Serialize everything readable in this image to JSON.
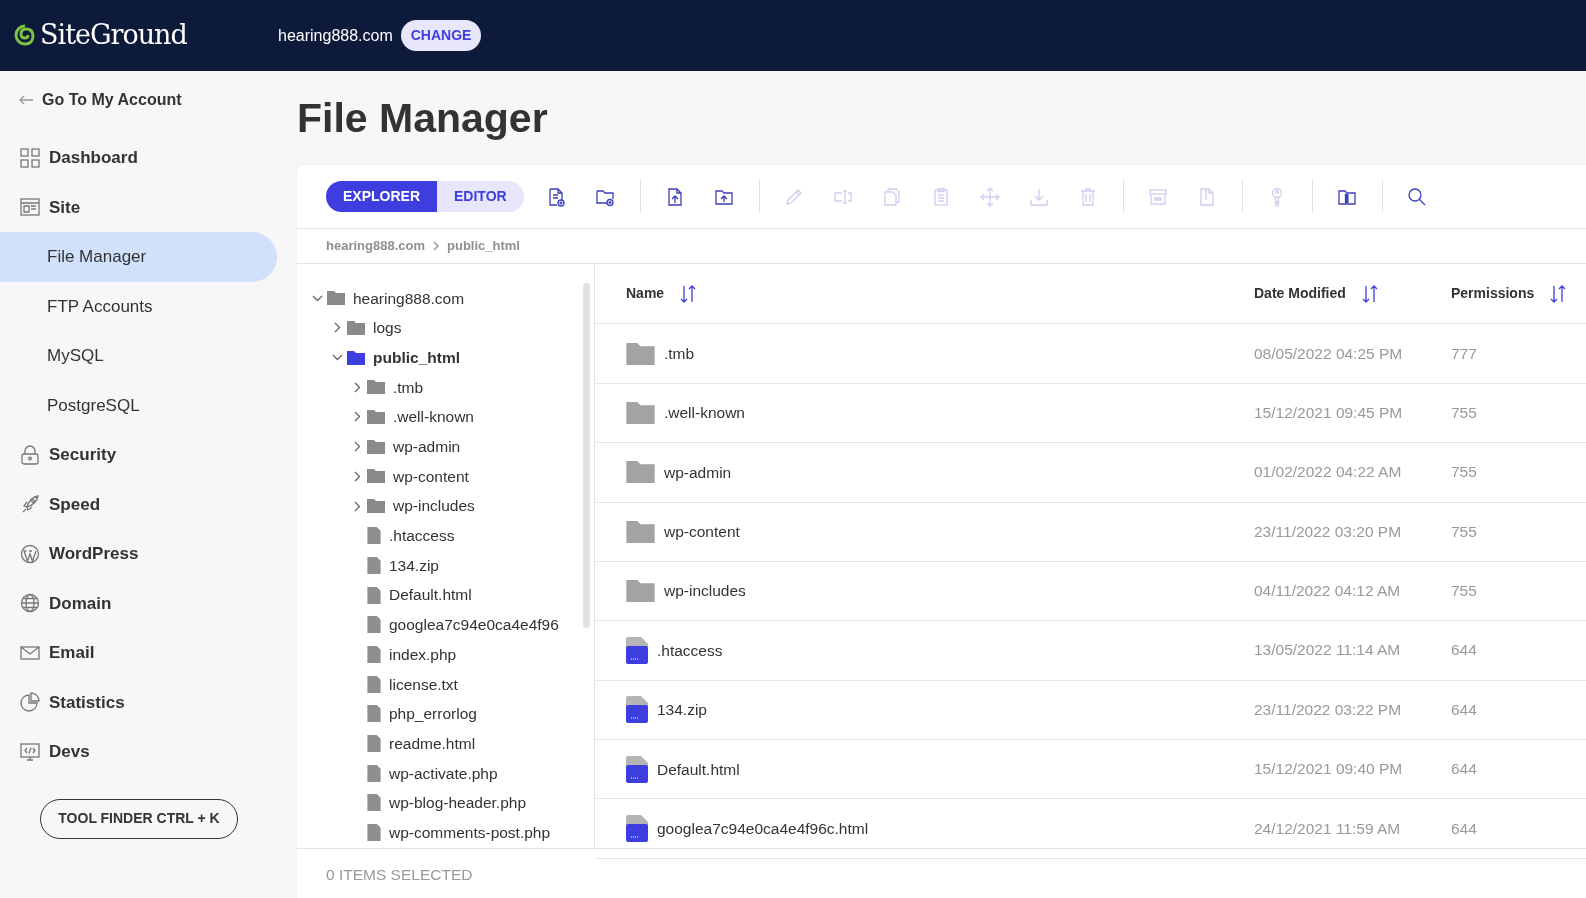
{
  "header": {
    "logo": "SiteGround",
    "site": "hearing888.com",
    "change_button": "CHANGE"
  },
  "sidebar": {
    "back_link": "Go To My Account",
    "items": [
      {
        "label": "Dashboard",
        "kind": "section",
        "selected": false
      },
      {
        "label": "Site",
        "kind": "section",
        "selected": false
      },
      {
        "label": "File Manager",
        "kind": "subitem",
        "selected": true
      },
      {
        "label": "FTP Accounts",
        "kind": "subitem",
        "selected": false
      },
      {
        "label": "MySQL",
        "kind": "subitem",
        "selected": false
      },
      {
        "label": "PostgreSQL",
        "kind": "subitem",
        "selected": false
      },
      {
        "label": "Security",
        "kind": "section",
        "selected": false
      },
      {
        "label": "Speed",
        "kind": "section",
        "selected": false
      },
      {
        "label": "WordPress",
        "kind": "section",
        "selected": false
      },
      {
        "label": "Domain",
        "kind": "section",
        "selected": false
      },
      {
        "label": "Email",
        "kind": "section",
        "selected": false
      },
      {
        "label": "Statistics",
        "kind": "section",
        "selected": false
      },
      {
        "label": "Devs",
        "kind": "section",
        "selected": false
      }
    ],
    "tool_finder": "TOOL FINDER CTRL + K"
  },
  "page_title": "File Manager",
  "toolbar": {
    "view_tabs": [
      {
        "label": "EXPLORER",
        "selected": true
      },
      {
        "label": "EDITOR",
        "selected": false
      }
    ],
    "tool_groups": [
      [
        {
          "kind": "new-file",
          "disabled": false
        },
        {
          "kind": "new-folder",
          "disabled": false
        }
      ],
      [
        {
          "kind": "upload-file",
          "disabled": false
        },
        {
          "kind": "upload-folder",
          "disabled": false
        }
      ],
      [
        {
          "kind": "edit",
          "disabled": true
        },
        {
          "kind": "rename",
          "disabled": true
        },
        {
          "kind": "copy",
          "disabled": true
        },
        {
          "kind": "paste",
          "disabled": true
        },
        {
          "kind": "move",
          "disabled": true
        },
        {
          "kind": "download",
          "disabled": true
        },
        {
          "kind": "delete",
          "disabled": true
        }
      ],
      [
        {
          "kind": "archive",
          "disabled": true
        },
        {
          "kind": "extract",
          "disabled": true
        }
      ],
      [
        {
          "kind": "permissions",
          "disabled": true
        }
      ],
      [
        {
          "kind": "info",
          "disabled": false
        }
      ],
      [
        {
          "kind": "search",
          "disabled": false
        }
      ]
    ]
  },
  "breadcrumb": [
    "hearing888.com",
    "public_html"
  ],
  "tree": [
    {
      "name": "hearing888.com",
      "kind": "folder",
      "expanded": true,
      "selected": false,
      "children": [
        {
          "name": "logs",
          "kind": "folder",
          "expanded": false,
          "selected": false
        },
        {
          "name": "public_html",
          "kind": "folder",
          "expanded": true,
          "selected": true,
          "children": [
            {
              "name": ".tmb",
              "kind": "folder",
              "expanded": false,
              "selected": false
            },
            {
              "name": ".well-known",
              "kind": "folder",
              "expanded": false,
              "selected": false
            },
            {
              "name": "wp-admin",
              "kind": "folder",
              "expanded": false,
              "selected": false
            },
            {
              "name": "wp-content",
              "kind": "folder",
              "expanded": false,
              "selected": false
            },
            {
              "name": "wp-includes",
              "kind": "folder",
              "expanded": false,
              "selected": false
            },
            {
              "name": ".htaccess",
              "kind": "file",
              "selected": false
            },
            {
              "name": "134.zip",
              "kind": "file",
              "selected": false
            },
            {
              "name": "Default.html",
              "kind": "file",
              "selected": false
            },
            {
              "name": "googlea7c94e0ca4e4f96",
              "kind": "file",
              "selected": false
            },
            {
              "name": "index.php",
              "kind": "file",
              "selected": false
            },
            {
              "name": "license.txt",
              "kind": "file",
              "selected": false
            },
            {
              "name": "php_errorlog",
              "kind": "file",
              "selected": false
            },
            {
              "name": "readme.html",
              "kind": "file",
              "selected": false
            },
            {
              "name": "wp-activate.php",
              "kind": "file",
              "selected": false
            },
            {
              "name": "wp-blog-header.php",
              "kind": "file",
              "selected": false
            },
            {
              "name": "wp-comments-post.php",
              "kind": "file",
              "selected": false
            }
          ]
        }
      ]
    }
  ],
  "table": {
    "columns": [
      "Name",
      "Date Modified",
      "Permissions"
    ],
    "rows": [
      {
        "name": ".tmb",
        "kind": "folder",
        "date": "08/05/2022 04:25 PM",
        "permissions": "777"
      },
      {
        "name": ".well-known",
        "kind": "folder",
        "date": "15/12/2021 09:45 PM",
        "permissions": "755"
      },
      {
        "name": "wp-admin",
        "kind": "folder",
        "date": "01/02/2022 04:22 AM",
        "permissions": "755"
      },
      {
        "name": "wp-content",
        "kind": "folder",
        "date": "23/11/2022 03:20 PM",
        "permissions": "755"
      },
      {
        "name": "wp-includes",
        "kind": "folder",
        "date": "04/11/2022 04:12 AM",
        "permissions": "755"
      },
      {
        "name": ".htaccess",
        "kind": "file",
        "date": "13/05/2022 11:14 AM",
        "permissions": "644"
      },
      {
        "name": "134.zip",
        "kind": "file",
        "date": "23/11/2022 03:22 PM",
        "permissions": "644"
      },
      {
        "name": "Default.html",
        "kind": "file",
        "date": "15/12/2021 09:40 PM",
        "permissions": "644"
      },
      {
        "name": "googlea7c94e0ca4e4f96c.html",
        "kind": "file",
        "date": "24/12/2021 11:59 AM",
        "permissions": "644"
      }
    ]
  },
  "status_bar": "0 ITEMS SELECTED"
}
